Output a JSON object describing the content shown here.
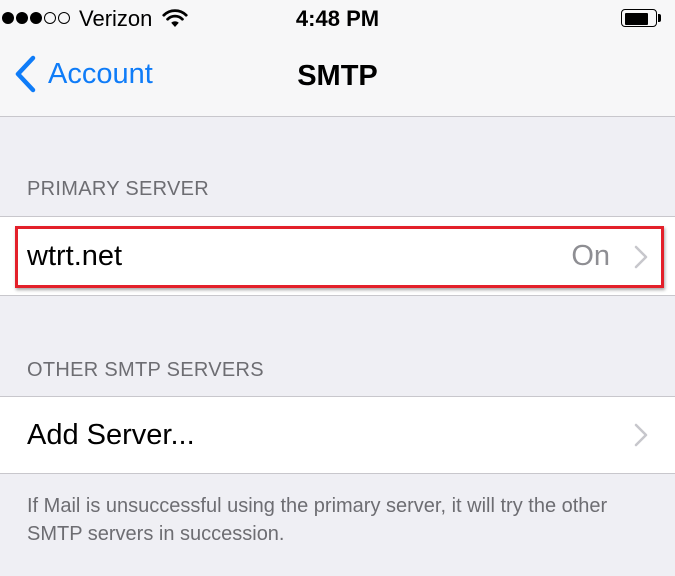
{
  "status_bar": {
    "signal_bars_filled": 3,
    "signal_bars_total": 5,
    "carrier": "Verizon",
    "wifi_icon": "wifi-icon",
    "time": "4:48 PM",
    "battery_level_percent": 85
  },
  "nav": {
    "back_label": "Account",
    "title": "SMTP"
  },
  "primary_section": {
    "header": "PRIMARY SERVER",
    "server_name": "wtrt.net",
    "server_status": "On"
  },
  "other_section": {
    "header": "OTHER SMTP SERVERS",
    "add_server_label": "Add Server..."
  },
  "footer": {
    "text": "If Mail is unsuccessful using the primary server, it will try the other SMTP servers in succession."
  },
  "colors": {
    "accent": "#0f7cf8",
    "background": "#efeff4",
    "secondary_text": "#6d6d72",
    "highlight": "#e3202a"
  }
}
